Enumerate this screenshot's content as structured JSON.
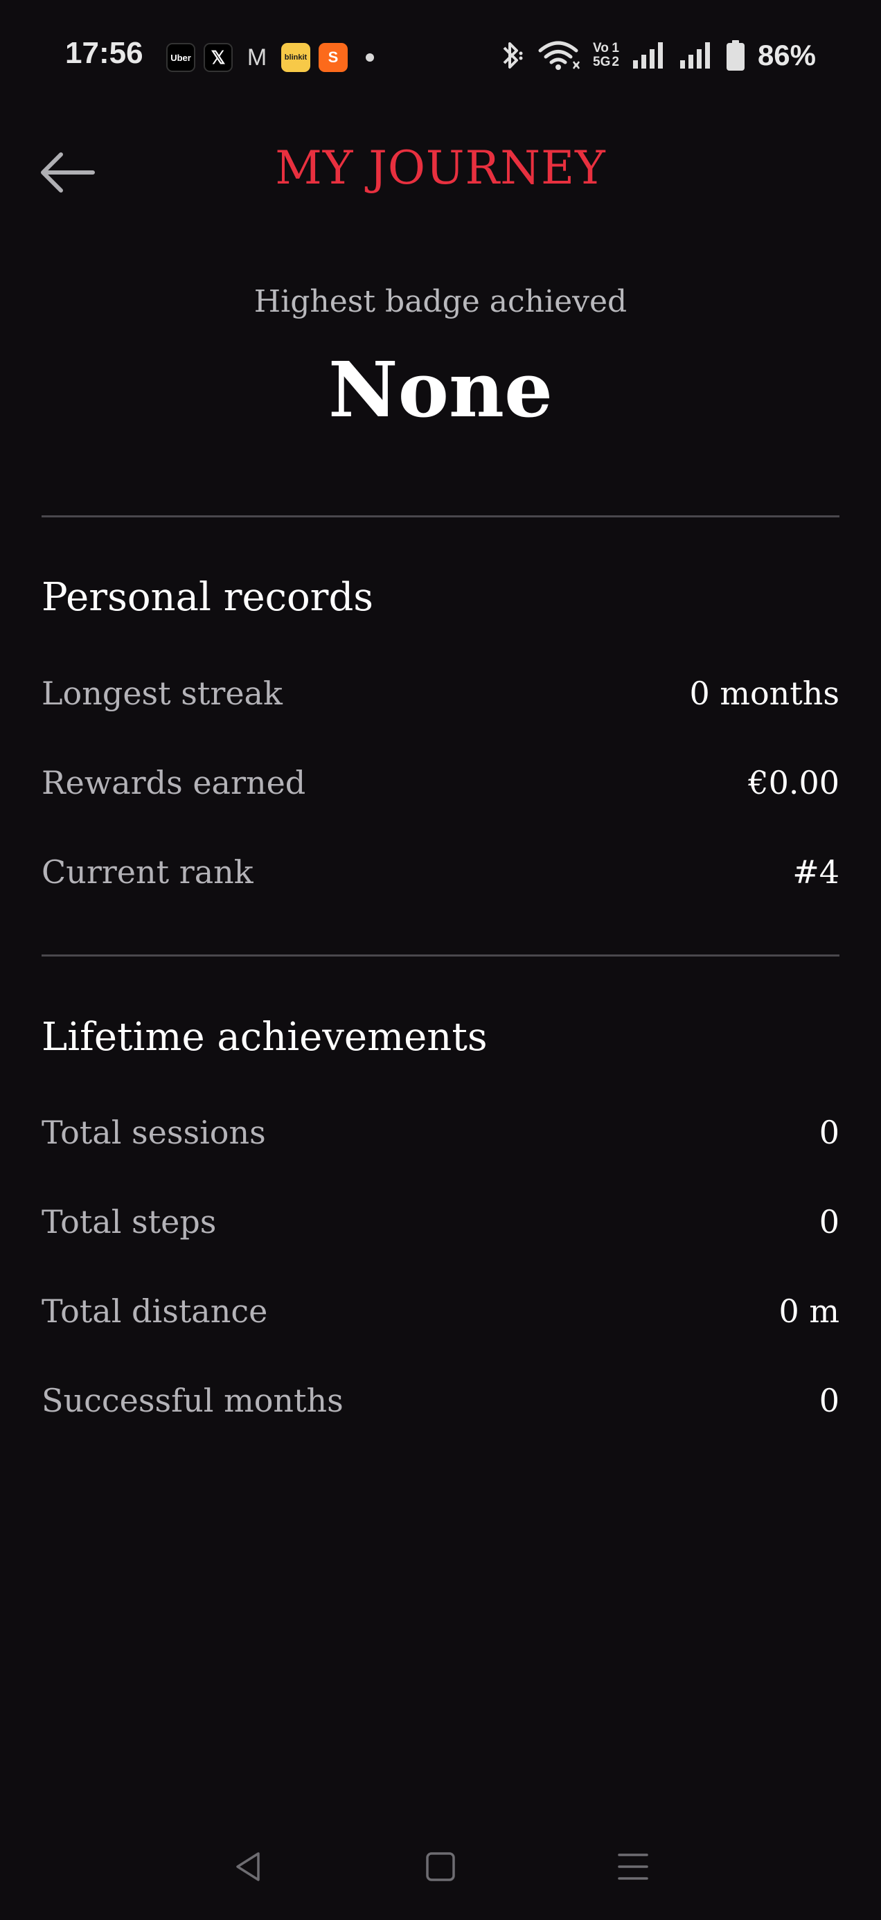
{
  "status_bar": {
    "time": "17:56",
    "notification_apps": [
      {
        "name": "uber-icon",
        "label": "Uber"
      },
      {
        "name": "x-icon",
        "label": "𝕏"
      },
      {
        "name": "gmail-icon",
        "label": "M"
      },
      {
        "name": "blinkit-icon",
        "label": "blinkit"
      },
      {
        "name": "swiggy-icon",
        "label": "S"
      }
    ],
    "battery_percent": "86%",
    "network_label_top": "Vo",
    "network_label_bottom": "5G",
    "sim1": "1",
    "sim2": "2"
  },
  "header": {
    "title": "MY JOURNEY",
    "back_icon": "arrow-left-icon"
  },
  "badge": {
    "caption": "Highest badge achieved",
    "value": "None"
  },
  "personal_records": {
    "title": "Personal records",
    "rows": [
      {
        "label": "Longest streak",
        "value": "0 months"
      },
      {
        "label": "Rewards earned",
        "value": "€0.00"
      },
      {
        "label": "Current rank",
        "value": "#4"
      }
    ]
  },
  "lifetime_achievements": {
    "title": "Lifetime achievements",
    "rows": [
      {
        "label": "Total sessions",
        "value": "0"
      },
      {
        "label": "Total steps",
        "value": "0"
      },
      {
        "label": "Total distance",
        "value": "0 m"
      },
      {
        "label": "Successful months",
        "value": "0"
      }
    ]
  },
  "nav_bar": {
    "back": "triangle-back-icon",
    "home": "square-home-icon",
    "menu": "menu-lines-icon"
  },
  "colors": {
    "background": "#0e0c0f",
    "accent": "#e8303f",
    "label": "#b4b3b8",
    "divider": "#4a484d"
  }
}
